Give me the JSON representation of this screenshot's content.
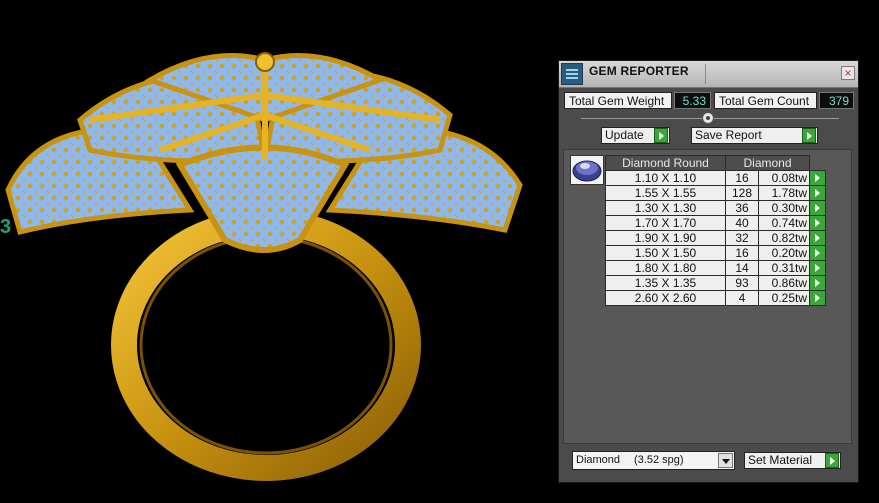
{
  "panel": {
    "title": "GEM REPORTER",
    "close_glyph": "×",
    "total_weight_label": "Total Gem Weight",
    "total_weight_value": "5.33",
    "total_count_label": "Total Gem Count",
    "total_count_value": "379",
    "update_label": "Update",
    "save_report_label": "Save Report",
    "set_material_label": "Set Material",
    "material_select": {
      "name": "Diamond",
      "spg": "(3.52 spg)"
    },
    "table": {
      "headers": [
        "Diamond Round",
        "Diamond"
      ],
      "rows": [
        {
          "size": "1.10 X 1.10",
          "count": "16",
          "weight": "0.08tw"
        },
        {
          "size": "1.55 X 1.55",
          "count": "128",
          "weight": "1.78tw"
        },
        {
          "size": "1.30 X 1.30",
          "count": "36",
          "weight": "0.30tw"
        },
        {
          "size": "1.70 X 1.70",
          "count": "40",
          "weight": "0.74tw"
        },
        {
          "size": "1.90 X 1.90",
          "count": "32",
          "weight": "0.82tw"
        },
        {
          "size": "1.50 X 1.50",
          "count": "16",
          "weight": "0.20tw"
        },
        {
          "size": "1.80 X 1.80",
          "count": "14",
          "weight": "0.31tw"
        },
        {
          "size": "1.35 X 1.35",
          "count": "93",
          "weight": "0.86tw"
        },
        {
          "size": "2.60 X 2.60",
          "count": "4",
          "weight": "0.25tw"
        }
      ]
    }
  },
  "icons": {
    "title": "gem-reporter-icon",
    "close": "close-icon",
    "gem": "diamond-gem-icon",
    "arrow": "play-arrow-icon",
    "dropdown": "chevron-down-icon"
  },
  "colors": {
    "panel_bg": "#4b4b4b",
    "value_text": "#6fe0d7",
    "arrow_button": "#39a836",
    "gold": "#d4a017",
    "gem_blue": "#8fb8ec"
  }
}
